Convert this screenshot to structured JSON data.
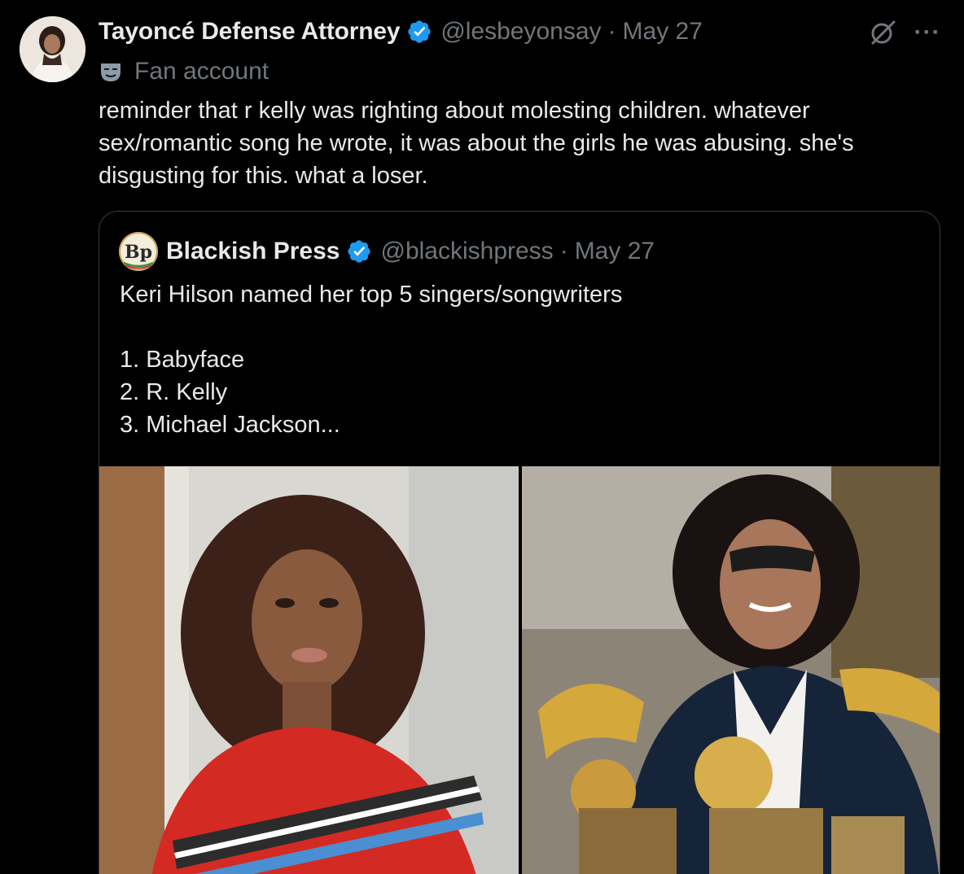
{
  "tweet": {
    "author": {
      "display_name": "Tayoncé Defense Attorney",
      "handle": "@lesbeyonsay",
      "date": "May 27",
      "label": "Fan account",
      "verified": true
    },
    "separator": "·",
    "more_label": "···",
    "text": "reminder that r kelly was righting about molesting children. whatever sex/romantic song he wrote, it was about the girls he was abusing. she's disgusting for this. what a loser."
  },
  "quote": {
    "author": {
      "display_name": "Blackish Press",
      "handle": "@blackishpress",
      "date": "May 27",
      "avatar_text": "Bp",
      "verified": true
    },
    "lines": [
      "Keri Hilson named her top 5 singers/songwriters",
      "",
      "1. Babyface",
      "2. R. Kelly",
      "3. Michael Jackson..."
    ],
    "media": [
      {
        "subject": "woman-in-red-striped-poncho-photo"
      },
      {
        "subject": "man-with-sunglasses-holding-grammys-photo"
      }
    ]
  },
  "colors": {
    "background": "#000000",
    "text_primary": "#e7e9ea",
    "text_secondary": "#71767b",
    "verified_blue": "#1d9bf0",
    "border": "#3a3e43"
  },
  "icons": [
    "verified-badge-icon",
    "grok-icon",
    "more-icon",
    "fan-account-mask-icon"
  ]
}
